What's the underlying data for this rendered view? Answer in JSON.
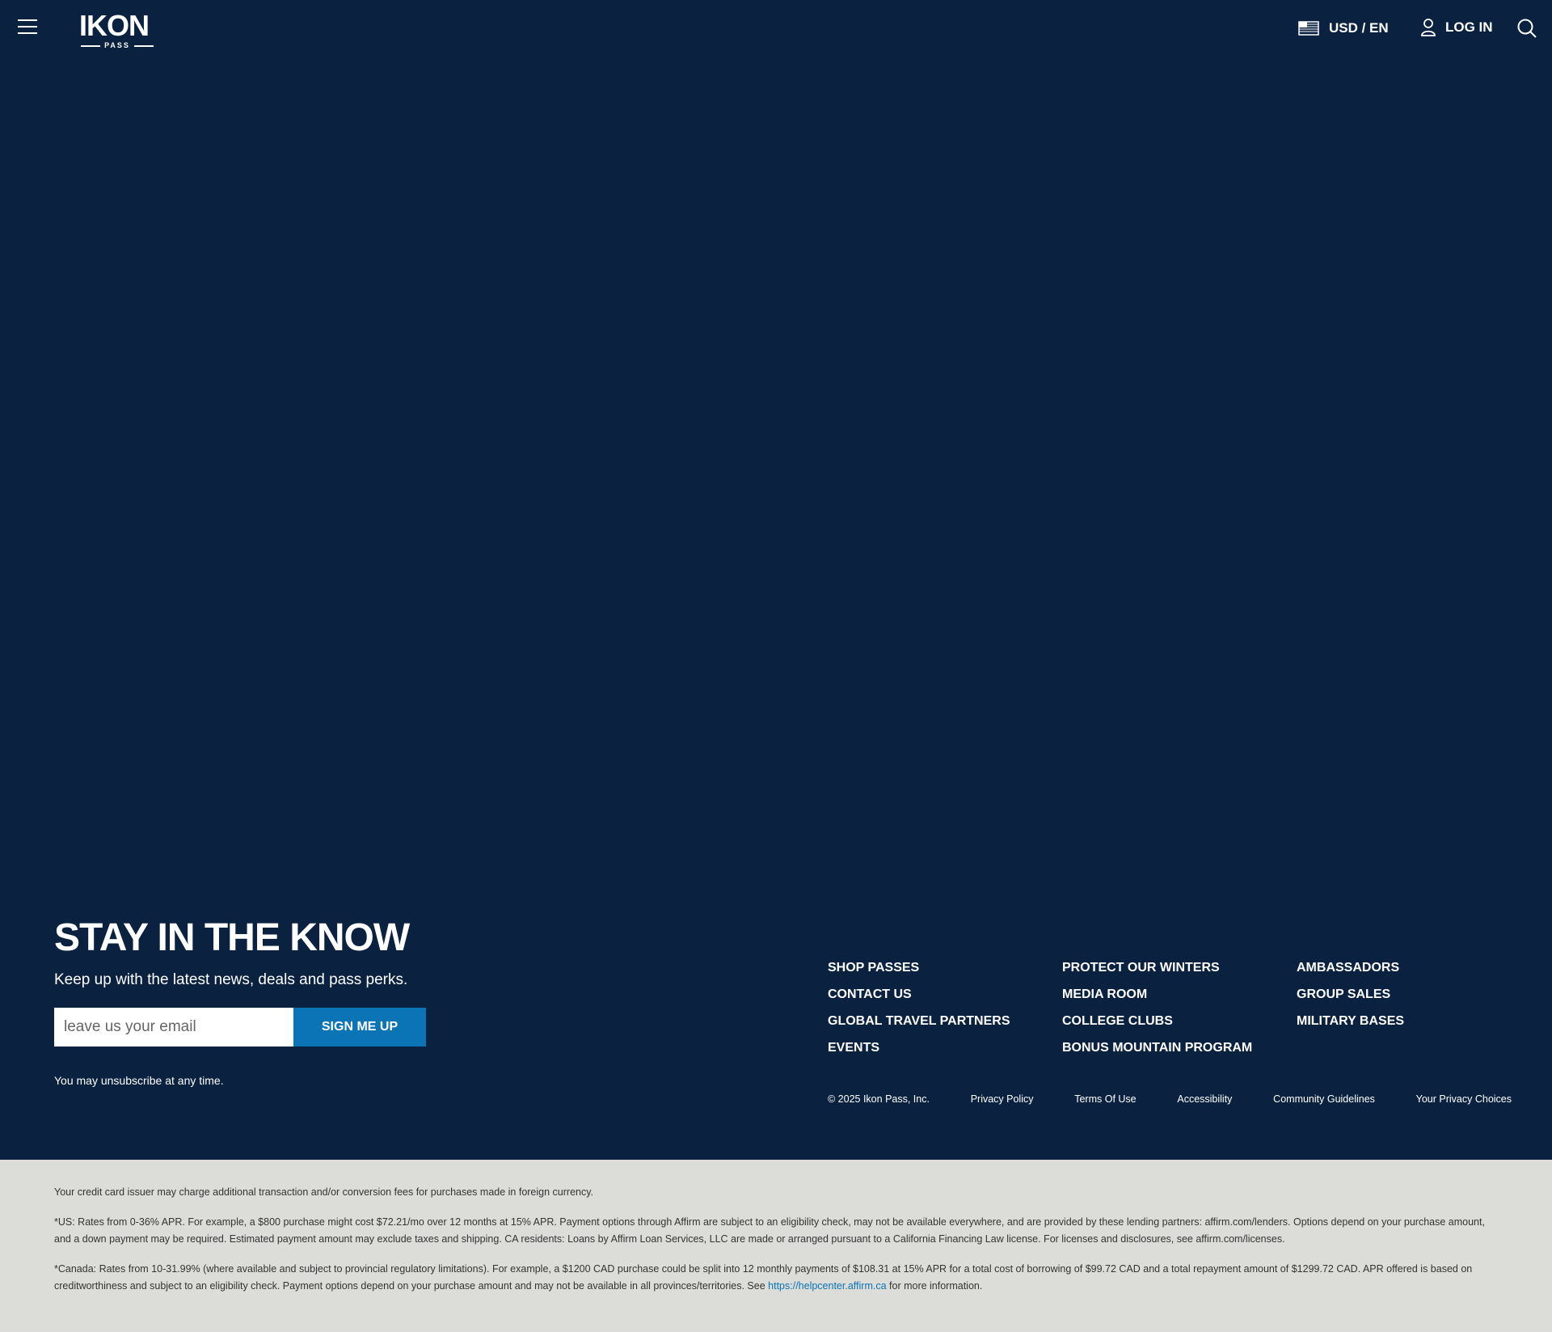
{
  "header": {
    "logo_main": "IKON",
    "logo_sub": "PASS",
    "locale_label": "USD / EN",
    "login_label": "LOG IN"
  },
  "signup": {
    "title": "STAY IN THE KNOW",
    "subtitle": "Keep up with the latest news, deals and pass perks.",
    "email_placeholder": "leave us your email",
    "button_label": "SIGN ME UP",
    "unsubscribe_note": "You may unsubscribe at any time."
  },
  "footer": {
    "columns": [
      [
        "SHOP PASSES",
        "CONTACT US",
        "GLOBAL TRAVEL PARTNERS",
        "EVENTS"
      ],
      [
        "PROTECT OUR WINTERS",
        "MEDIA ROOM",
        "COLLEGE CLUBS",
        "BONUS MOUNTAIN PROGRAM"
      ],
      [
        "AMBASSADORS",
        "GROUP SALES",
        "MILITARY BASES"
      ]
    ],
    "copyright": "© 2025 Ikon Pass, Inc.",
    "legal_links": [
      "Privacy Policy",
      "Terms Of Use",
      "Accessibility",
      "Community Guidelines",
      "Your Privacy Choices"
    ]
  },
  "disclaimer": {
    "foreign_fees": "Your credit card issuer may charge additional transaction and/or conversion fees for purchases made in foreign currency.",
    "us_terms": "*US: Rates from 0-36% APR. For example, a $800 purchase might cost $72.21/mo over 12 months at 15% APR. Payment options through Affirm are subject to an eligibility check, may not be available everywhere, and are provided by these lending partners: affirm.com/lenders. Options depend on your purchase amount, and a down payment may be required. Estimated payment amount may exclude taxes and shipping. CA residents: Loans by Affirm Loan Services, LLC are made or arranged pursuant to a California Financing Law license. For licenses and disclosures, see affirm.com/licenses.",
    "canada_terms": "*Canada: Rates from 10-31.99% (where available and subject to provincial regulatory limitations). For example, a $1200 CAD purchase could be split into 12 monthly payments of $108.31 at 15% APR for a total cost of borrowing of $99.72 CAD and a total repayment amount of $1299.72 CAD. APR offered is based on creditworthiness and subject to an eligibility check. Payment options depend on your purchase amount and may not be available in all provinces/territories. See",
    "canada_link": "https://helpcenter.affirm.ca",
    "canada_suffix": "for more information."
  },
  "colors": {
    "navy": "#0a2240",
    "accent_blue": "#0a74b6",
    "disclaimer_bg": "#dcdcd9"
  }
}
